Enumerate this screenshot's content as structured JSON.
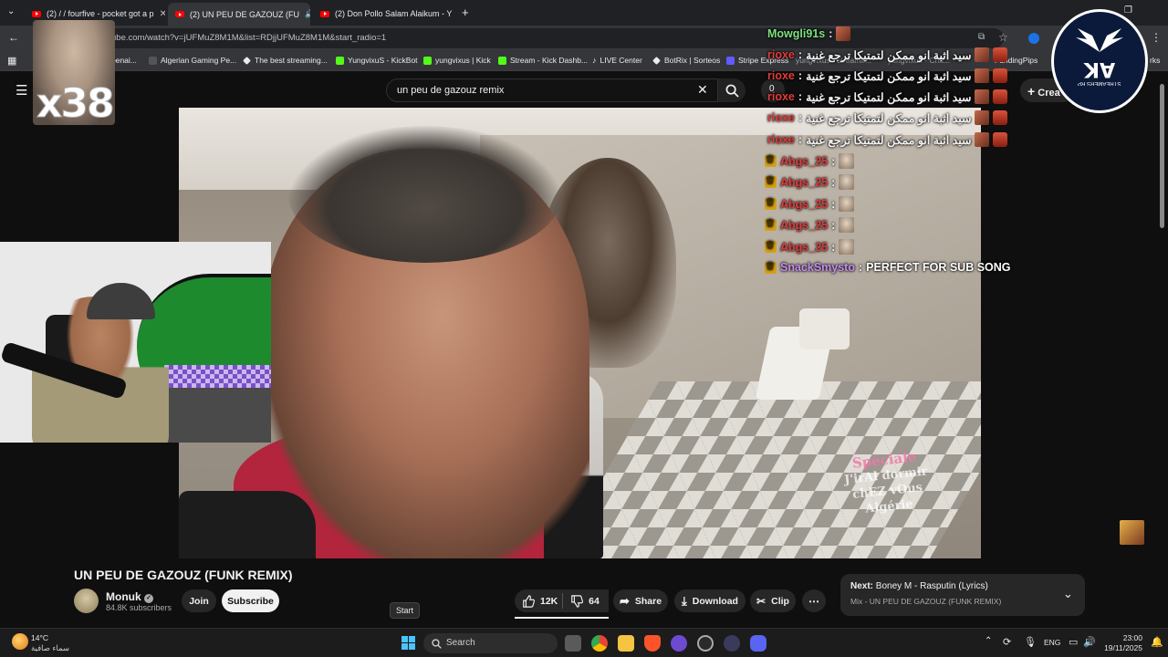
{
  "browser": {
    "tabs": [
      {
        "label": "(2) / / fourfive - pocket got a p",
        "active": false
      },
      {
        "label": "(2) UN PEU DE GAZOUZ (FU",
        "active": true
      },
      {
        "label": "(2) Don Pollo Salam Alaikum - Y",
        "active": false
      }
    ],
    "url": "ube.com/watch?v=jUFMuZ8M1M&list=RDjjUFMuZ8M1M&start_radio=1",
    "bookmarks": [
      {
        "label": "benai...",
        "color": "#1a73e8"
      },
      {
        "label": "Algerian Gaming Pe...",
        "color": "#e8eaed"
      },
      {
        "label": "The best streaming...",
        "color": "#e8eaed"
      },
      {
        "label": "YungvixuS - KickBot",
        "color": "#53fc18"
      },
      {
        "label": "yungvixus | Kick",
        "color": "#53fc18"
      },
      {
        "label": "Stream - Kick Dashb...",
        "color": "#53fc18"
      },
      {
        "label": "LIVE Center",
        "color": "#e8eaed"
      },
      {
        "label": "BotRix | Sorteos",
        "color": "#e8eaed"
      },
      {
        "label": "Stripe Express",
        "color": "#635bff"
      },
      {
        "label": "yungvixus - streame...",
        "color": "#e8eaed"
      },
      {
        "label": "yungvixus - Cha...",
        "color": "#e8eaed"
      },
      {
        "label": "FundingPips",
        "color": "#e8eaed"
      },
      {
        "label": "rks",
        "color": "#e8eaed"
      }
    ]
  },
  "youtube": {
    "search_value": "un peu de gazouz remix",
    "create_label": "Crea",
    "notif_count": "0",
    "video_title": "UN PEU DE GAZOUZ (FUNK REMIX)",
    "channel_name": "Monuk",
    "subscribers": "84.8K subscribers",
    "join_label": "Join",
    "subscribe_label": "Subscribe",
    "likes": "12K",
    "dislikes": "64",
    "share_label": "Share",
    "download_label": "Download",
    "clip_label": "Clip",
    "next_prefix": "Next:",
    "next_title": "Boney M - Rasputin (Lyrics)",
    "mix_label": "Mix - UN PEU DE GAZOUZ (FUNK REMIX)",
    "watermark_line1": "Spéciale",
    "watermark_line2": "J'irAl dormir",
    "watermark_line3": "chEZ vOus",
    "watermark_line4": "Algérie"
  },
  "overlay": {
    "alert_count": "x38",
    "logo_text": "AK",
    "logo_sub": "STREAMERS RP",
    "chat": [
      {
        "user": "Mowgli91s",
        "sep": ":",
        "msg": "",
        "user_color": "#7fe07f"
      },
      {
        "user": "rioxe",
        "sep": ":",
        "msg": "سيد اثبة انو ممكن لتمتيكا ترجع غنية",
        "user_color": "#e03c3c"
      },
      {
        "user": "rioxe",
        "sep": ":",
        "msg": "سيد اثبة انو ممكن لتمتيكا ترجع غنية",
        "user_color": "#e03c3c"
      },
      {
        "user": "rioxe",
        "sep": ":",
        "msg": "سيد اثبة انو ممكن لتمتيكا ترجع غنية",
        "user_color": "#e03c3c"
      },
      {
        "user": "rioxe",
        "sep": ":",
        "msg": "سيد اثبة انو ممكن لتمتيكا ترجع غنية",
        "user_color": "#e03c3c"
      },
      {
        "user": "rioxe",
        "sep": ":",
        "msg": "سيد اثبة انو ممكن لتمتيكا ترجع غنية",
        "user_color": "#e03c3c"
      },
      {
        "user": "Abgs_25",
        "sep": ":",
        "msg": "",
        "user_color": "#e03c3c"
      },
      {
        "user": "Abgs_25",
        "sep": ":",
        "msg": "",
        "user_color": "#e03c3c"
      },
      {
        "user": "Abgs_25",
        "sep": ":",
        "msg": "",
        "user_color": "#e03c3c"
      },
      {
        "user": "Abgs_25",
        "sep": ":",
        "msg": "",
        "user_color": "#e03c3c"
      },
      {
        "user": "Abgs_25",
        "sep": ":",
        "msg": "",
        "user_color": "#e03c3c"
      },
      {
        "user": "SnackSmysto",
        "sep": ":",
        "msg": "PERFECT FOR SUB SONG",
        "user_color": "#c58cf0"
      }
    ]
  },
  "taskbar": {
    "tooltip": "Start",
    "weather_temp": "14°C",
    "weather_desc": "سماء صافية",
    "search_label": "Search",
    "lang": "ENG",
    "time": "23:00",
    "date": "19/11/2025"
  }
}
